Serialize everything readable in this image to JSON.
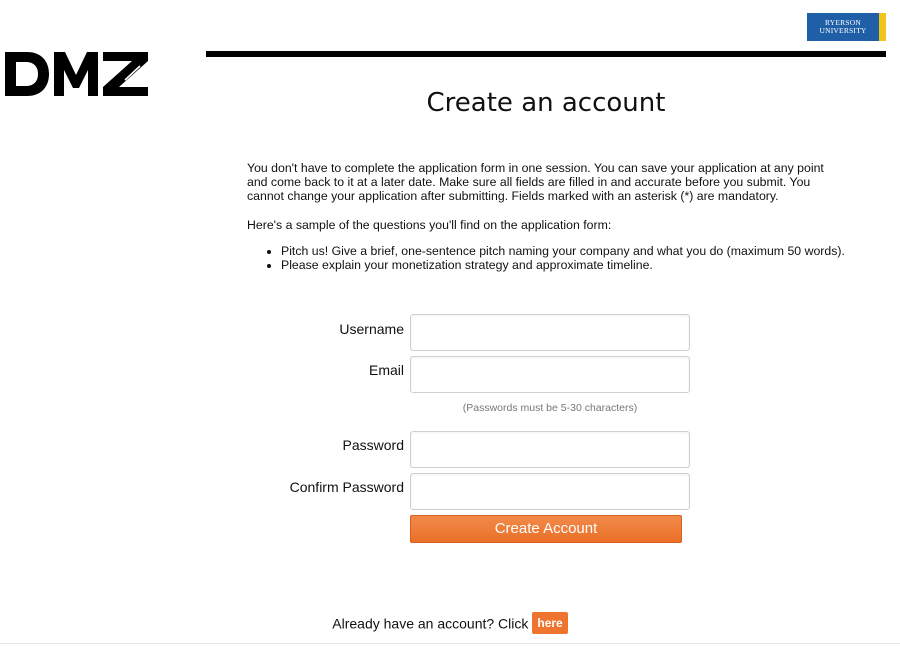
{
  "header": {
    "logo_text": "DMZ",
    "university_logo": {
      "line1": "RYERSON",
      "line2": "UNIVERSITY",
      "bg_color": "#1f5fa8",
      "accent_color": "#f2c318"
    }
  },
  "main": {
    "title": "Create an account",
    "intro": "You don't have to complete the application form in one session. You can save your application at any point and come back to it at a later date. Make sure all fields are filled in and accurate before you submit. You cannot change your application after submitting. Fields marked with an asterisk (*) are mandatory.",
    "sample_heading": "Here's a sample of the questions you'll find on the application form:",
    "sample_questions": [
      "Pitch us! Give a brief, one-sentence pitch naming your company and what you do (maximum 50 words).",
      "Please explain your monetization strategy and approximate timeline."
    ]
  },
  "form": {
    "username_label": "Username",
    "username_value": "",
    "email_label": "Email",
    "email_value": "",
    "password_hint": "(Passwords must be 5-30 characters)",
    "password_label": "Password",
    "password_value": "",
    "confirm_password_label": "Confirm Password",
    "confirm_password_value": "",
    "submit_label": "Create Account",
    "submit_color": "#ee7430"
  },
  "footer": {
    "login_prompt": "Already have an account? Click",
    "login_link": "here"
  }
}
